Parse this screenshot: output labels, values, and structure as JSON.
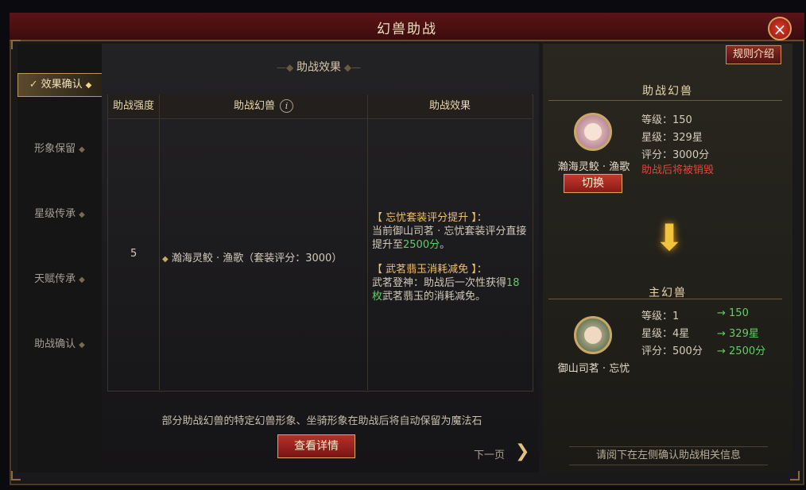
{
  "window": {
    "title": "幻兽助战",
    "close_icon": "×"
  },
  "sidebar": {
    "items": [
      {
        "label": "效果确认",
        "active": true
      },
      {
        "label": "形象保留",
        "active": false
      },
      {
        "label": "星级传承",
        "active": false
      },
      {
        "label": "天赋传承",
        "active": false
      },
      {
        "label": "助战确认",
        "active": false
      }
    ]
  },
  "main": {
    "section_title": "助战效果",
    "table": {
      "headers": [
        "助战强度",
        "助战幻兽",
        "助战效果"
      ],
      "info_icon": "i",
      "row": {
        "strength": "5",
        "pet": "瀚海灵鲛 · 渔歌（套装评分：3000）",
        "effects": [
          {
            "title": "【 忘忧套装评分提升 】：",
            "text_before": "当前御山司茗 · 忘忧套装评分直接提升至",
            "highlight": "2500分",
            "text_after": "。"
          },
          {
            "title": "【 武茗翡玉消耗减免 】：",
            "text_before": "武茗登神：助战后一次性获得",
            "highlight": "18枚",
            "text_after": "武茗翡玉的消耗减免。"
          }
        ]
      }
    },
    "bottom_note": "部分助战幻兽的特定幻兽形象、坐骑形象在助战后将自动保留为魔法石",
    "detail_button": "查看详情",
    "next_page": "下一页"
  },
  "right": {
    "rules_button": "规则介绍",
    "assist_header": "助战幻兽",
    "assist_pet": {
      "name": "瀚海灵鲛 · 渔歌",
      "level": "等级：150",
      "stars": "星级：329星",
      "score": "评分：3000分",
      "warning": "助战后将被销毁",
      "switch_button": "切换"
    },
    "main_header": "主幻兽",
    "main_pet": {
      "name": "御山司茗 · 忘忧",
      "level": "等级：1",
      "level_to": "→ 150",
      "stars": "星级：4星",
      "stars_to": "→ 329星",
      "score": "评分：500分",
      "score_to": "→ 2500分"
    },
    "footer_tip": "请阅下在左侧确认助战相关信息"
  },
  "colors": {
    "accent_gold": "#e8d6aa",
    "highlight_green": "#5ed061",
    "warning_red": "#e4433a",
    "title_bar": "#5d1416"
  }
}
